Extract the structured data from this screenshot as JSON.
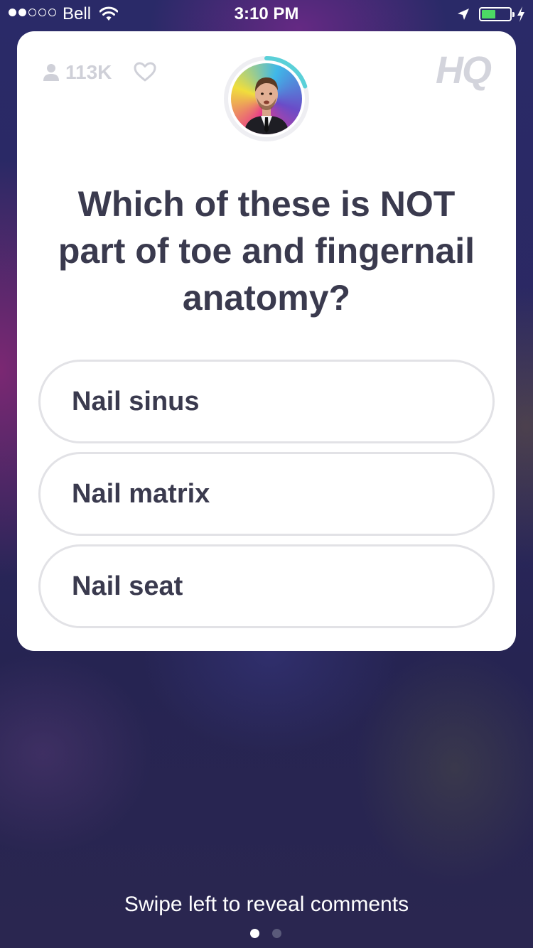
{
  "status_bar": {
    "carrier": "Bell",
    "time": "3:10 PM",
    "signal_bars_filled": 2,
    "signal_bars_total": 5,
    "battery_level": 0.5,
    "battery_color": "#4cd964"
  },
  "card": {
    "viewer_count": "113K",
    "logo": "HQ",
    "timer_progress": 0.2,
    "timer_color": "#5ad0d8"
  },
  "question": {
    "text": "Which of these is NOT part of toe and fingernail anatomy?"
  },
  "answers": [
    {
      "label": "Nail sinus"
    },
    {
      "label": "Nail matrix"
    },
    {
      "label": "Nail seat"
    }
  ],
  "footer": {
    "hint": "Swipe left to reveal comments",
    "page_count": 2,
    "current_page": 1
  }
}
